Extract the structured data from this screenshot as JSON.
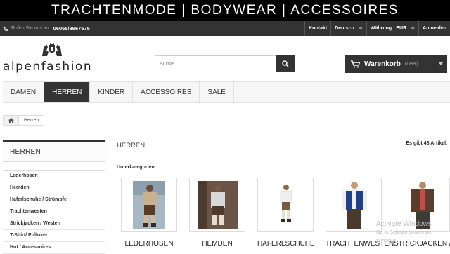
{
  "banner": {
    "text": "TRACHTENMODE | BODYWEAR | ACCESSOIRES"
  },
  "topbar": {
    "phone_label": "Rufen Sie uns an:",
    "phone_number": "06055/8967575",
    "contact": "Kontakt",
    "language": "Deutsch",
    "currency": "Währung : EUR",
    "login": "Anmelden"
  },
  "logo": {
    "text": "alpenfashion"
  },
  "search": {
    "placeholder": "Suche"
  },
  "cart": {
    "label": "Warenkorb",
    "status": "(Leer)"
  },
  "nav": {
    "tabs": [
      "DAMEN",
      "HERREN",
      "KINDER",
      "ACCESSOIRES",
      "SALE"
    ],
    "active": "HERREN"
  },
  "breadcrumb": {
    "current": "Herren"
  },
  "sidebar": {
    "title": "HERREN",
    "items": [
      "Lederhosen",
      "Hemden",
      "Haferlschuhe / Strümpfe",
      "Trachtenwesten",
      "Strickjacken / Westen",
      "T-Shirt/ Pullover",
      "Hut / Accessoires"
    ]
  },
  "main": {
    "title": "HERREN",
    "count": "Es gibt 43 Artikel.",
    "subcategories_label": "Unterkategorien",
    "cards": [
      "LEDERHOSEN",
      "HEMDEN",
      "HAFERLSCHUHE",
      "TRACHTENWESTEN",
      "STRICKJACKEN /"
    ]
  },
  "watermark": {
    "line1": "Activate Windows",
    "line2": "Go to Settings to activate Windows."
  },
  "colors": {
    "dark": "#333333",
    "banner": "#000000",
    "nav_active": "#333333"
  }
}
